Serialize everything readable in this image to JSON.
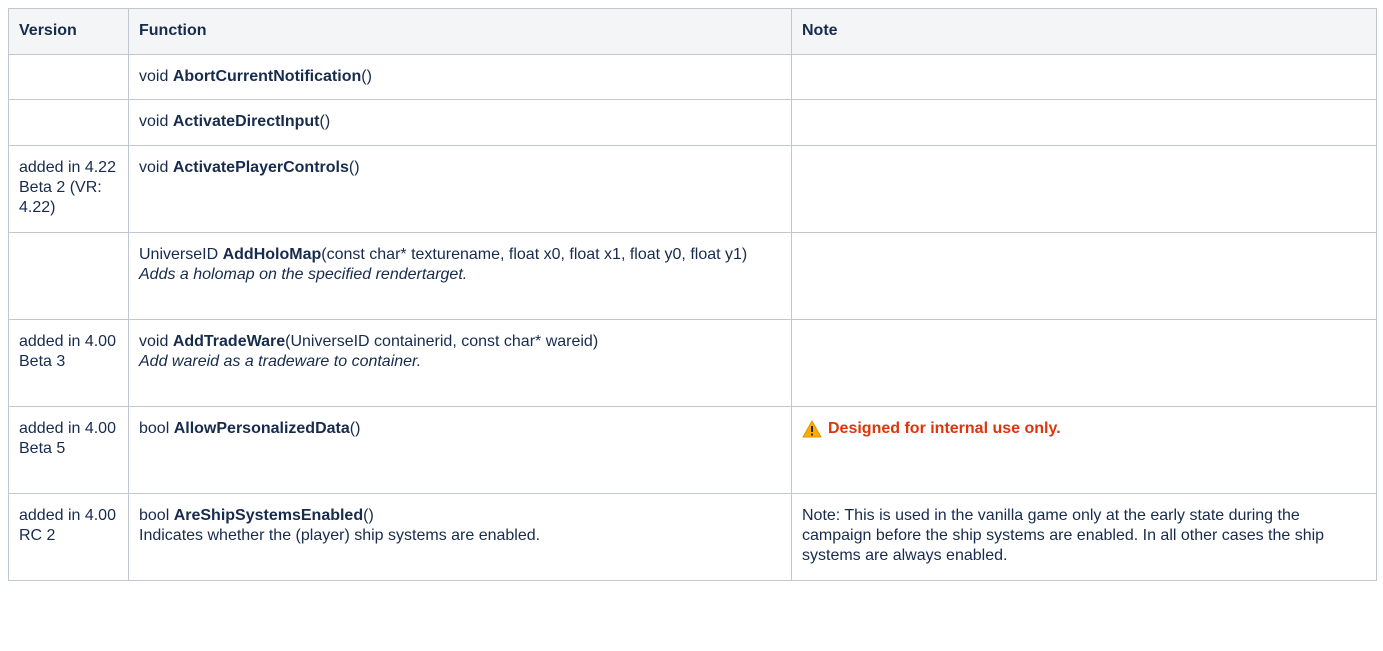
{
  "headers": {
    "version": "Version",
    "function": "Function",
    "note": "Note"
  },
  "rows": [
    {
      "version": "",
      "return_type": "void",
      "name": "AbortCurrentNotification",
      "params": "()",
      "description": "",
      "note": ""
    },
    {
      "version": "",
      "return_type": "void",
      "name": "ActivateDirectInput",
      "params": "()",
      "description": "",
      "note": ""
    },
    {
      "version": "added in 4.22 Beta 2 (VR: 4.22)",
      "return_type": "void",
      "name": "ActivatePlayerControls",
      "params": "()",
      "description": "",
      "note": ""
    },
    {
      "version": "",
      "return_type": "UniverseID",
      "name": "AddHoloMap",
      "params": "(const char* texturename, float x0, float x1, float y0, float y1)",
      "description": "Adds a holomap on the specified rendertarget.",
      "note": ""
    },
    {
      "version": "added in 4.00 Beta 3",
      "return_type": "void",
      "name": "AddTradeWare",
      "params": "(UniverseID containerid, const char* wareid)",
      "description": "Add wareid as a tradeware to container.",
      "note": ""
    },
    {
      "version": "added in 4.00 Beta 5",
      "return_type": "bool",
      "name": "AllowPersonalizedData",
      "params": "()",
      "description": "",
      "note": "Designed for internal use only.",
      "note_icon": "warning-icon"
    },
    {
      "version": "added in 4.00 RC 2",
      "return_type": "bool",
      "name": "AreShipSystemsEnabled",
      "params": "()",
      "description": "Indicates whether the (player) ship systems are enabled.",
      "note": "Note: This is used in the vanilla game only at the early state during the campaign before the ship systems are enabled. In all other cases the ship systems are always enabled."
    }
  ],
  "colors": {
    "header_bg": "#f4f5f7",
    "border": "#c1c7d0",
    "text": "#172b4d",
    "warning_text": "#de350b",
    "warning_icon": "#ffab00"
  }
}
